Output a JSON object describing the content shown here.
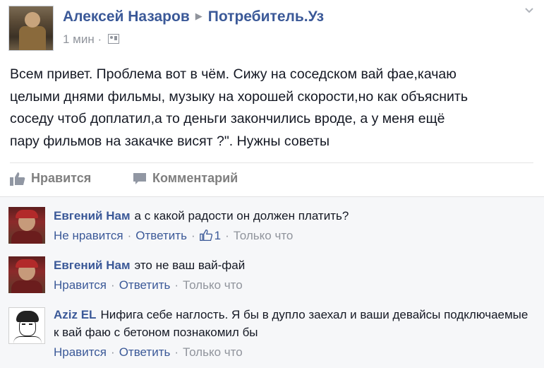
{
  "post": {
    "author": "Алексей Назаров",
    "arrow_glyph": "▶",
    "target": "Потребитель.Уз",
    "time": "1 мин",
    "meta_sep": "·",
    "text": "Всем привет. Проблема вот в чём. Сижу на соседском вай фае,качаю\nцелыми днями фильмы, музыку на хорошей скорости,но как объяснить\nсоседу чтоб доплатил,а то деньги закончились вроде, а у меня ещё\nпару фильмов на закачке висят ?\". Нужны советы"
  },
  "actions": {
    "like_label": "Нравится",
    "comment_label": "Комментарий"
  },
  "comments": [
    {
      "author": "Евгений Нам",
      "text": "а с какой радости он должен платить?",
      "like_label": "Не нравится",
      "reply_label": "Ответить",
      "likes": "1",
      "time": "Только что",
      "sep": "·"
    },
    {
      "author": "Евгений Нам",
      "text": "это не ваш вай-фай",
      "like_label": "Нравится",
      "reply_label": "Ответить",
      "time": "Только что",
      "sep": "·"
    },
    {
      "author": "Aziz EL",
      "text": "Нифига себе наглость. Я бы в дупло заехал и ваши девайсы подключаемые к вай фаю с бетоном познакомил бы",
      "like_label": "Нравится",
      "reply_label": "Ответить",
      "time": "Только что",
      "sep": "·"
    }
  ],
  "icons": {
    "audience": "friends-icon",
    "menu": "chevron-down-icon",
    "like": "thumbs-up-icon",
    "comment": "comment-bubble-icon"
  },
  "colors": {
    "link": "#3b5998",
    "muted": "#90949c",
    "comments_bg": "#f6f7f9",
    "text": "#141823"
  }
}
